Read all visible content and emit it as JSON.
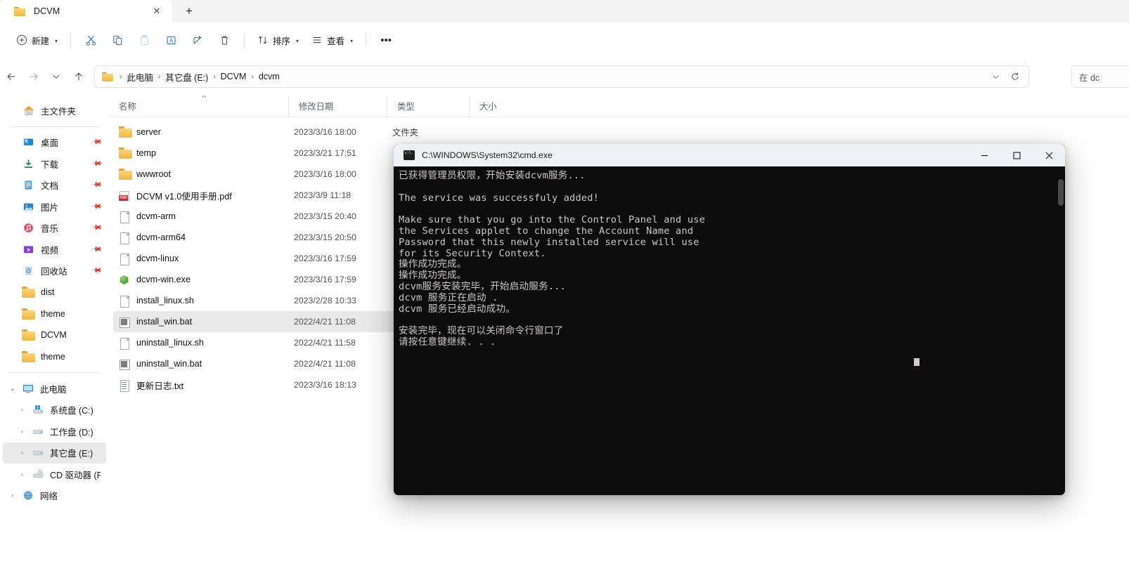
{
  "window": {
    "tab": {
      "title": "DCVM",
      "close_label": "✕",
      "newtab_label": "+"
    }
  },
  "toolbar": {
    "new_label": "新建",
    "cut_label": "cut-icon",
    "copy_label": "copy-icon",
    "paste_label": "paste-icon",
    "rename_label": "rename-icon",
    "share_label": "share-icon",
    "delete_label": "delete-icon",
    "sort_label": "排序",
    "view_label": "查看",
    "more_label": "•••"
  },
  "address": {
    "crumbs": [
      "此电脑",
      "其它盘 (E:)",
      "DCVM",
      "dcvm"
    ],
    "separator": "›",
    "dropdown_label": "⌄",
    "refresh_label": "↻"
  },
  "search": {
    "text": "在 dc"
  },
  "sidebar": {
    "home": {
      "label": "主文件夹",
      "icon": "home-icon"
    },
    "quick": [
      {
        "label": "桌面",
        "icon": "desktop-icon",
        "pinned": true
      },
      {
        "label": "下载",
        "icon": "downloads-icon",
        "pinned": true
      },
      {
        "label": "文档",
        "icon": "documents-icon",
        "pinned": true
      },
      {
        "label": "图片",
        "icon": "pictures-icon",
        "pinned": true
      },
      {
        "label": "音乐",
        "icon": "music-icon",
        "pinned": true
      },
      {
        "label": "视频",
        "icon": "videos-icon",
        "pinned": true
      },
      {
        "label": "回收站",
        "icon": "recyclebin-icon",
        "pinned": true
      },
      {
        "label": "dist",
        "icon": "folder-icon",
        "pinned": false
      },
      {
        "label": "theme",
        "icon": "folder-icon",
        "pinned": false
      },
      {
        "label": "DCVM",
        "icon": "folder-icon",
        "pinned": false
      },
      {
        "label": "theme",
        "icon": "folder-icon",
        "pinned": false
      }
    ],
    "thispc": {
      "label": "此电脑",
      "icon": "pc-icon",
      "expanded": true
    },
    "drives": [
      {
        "label": "系统盘 (C:)",
        "icon": "windrive-icon",
        "selected": false
      },
      {
        "label": "工作盘 (D:)",
        "icon": "drive-icon",
        "selected": false
      },
      {
        "label": "其它盘 (E:)",
        "icon": "drive-icon",
        "selected": true
      },
      {
        "label": "CD 驱动器 (F:)",
        "icon": "cd-icon",
        "selected": false
      }
    ],
    "network": {
      "label": "网络",
      "icon": "network-icon"
    },
    "expander_collapsed": "›",
    "expander_expanded": "⌄"
  },
  "filelist": {
    "columns": [
      "名称",
      "修改日期",
      "类型",
      "大小"
    ],
    "sort_caret": "˄",
    "rows": [
      {
        "name": "server",
        "date": "2023/3/16 18:00",
        "type": "文件夹",
        "size": "",
        "icon": "folder-icon",
        "selected": false
      },
      {
        "name": "temp",
        "date": "2023/3/21 17:51",
        "type": "",
        "size": "",
        "icon": "folder-icon",
        "selected": false
      },
      {
        "name": "wwwroot",
        "date": "2023/3/16 18:00",
        "type": "",
        "size": "",
        "icon": "folder-icon",
        "selected": false
      },
      {
        "name": "DCVM v1.0使用手册.pdf",
        "date": "2023/3/9 11:18",
        "type": "",
        "size": "",
        "icon": "pdf-icon",
        "selected": false
      },
      {
        "name": "dcvm-arm",
        "date": "2023/3/15 20:40",
        "type": "",
        "size": "",
        "icon": "file-icon",
        "selected": false
      },
      {
        "name": "dcvm-arm64",
        "date": "2023/3/15 20:50",
        "type": "",
        "size": "",
        "icon": "file-icon",
        "selected": false
      },
      {
        "name": "dcvm-linux",
        "date": "2023/3/16 17:59",
        "type": "",
        "size": "",
        "icon": "file-icon",
        "selected": false
      },
      {
        "name": "dcvm-win.exe",
        "date": "2023/3/16 17:59",
        "type": "",
        "size": "",
        "icon": "exe-icon",
        "selected": false
      },
      {
        "name": "install_linux.sh",
        "date": "2023/2/28 10:33",
        "type": "",
        "size": "",
        "icon": "file-icon",
        "selected": false
      },
      {
        "name": "install_win.bat",
        "date": "2022/4/21 11:08",
        "type": "",
        "size": "",
        "icon": "bat-icon",
        "selected": true
      },
      {
        "name": "uninstall_linux.sh",
        "date": "2022/4/21 11:58",
        "type": "",
        "size": "",
        "icon": "file-icon",
        "selected": false
      },
      {
        "name": "uninstall_win.bat",
        "date": "2022/4/21 11:08",
        "type": "",
        "size": "",
        "icon": "bat-icon",
        "selected": false
      },
      {
        "name": "更新日志.txt",
        "date": "2023/3/16 18:13",
        "type": "",
        "size": "",
        "icon": "txt-icon",
        "selected": false
      }
    ]
  },
  "console": {
    "title": "C:\\WINDOWS\\System32\\cmd.exe",
    "minimize_label": "—",
    "maximize_label": "☐",
    "close_label": "✕",
    "output": "已获得管理员权限，开始安装dcvm服务...\n\nThe service was successfuly added!\n\nMake sure that you go into the Control Panel and use\nthe Services applet to change the Account Name and\nPassword that this newly installed service will use\nfor its Security Context.\n操作成功完成。\n操作成功完成。\ndcvm服务安装完毕，开始启动服务...\ndcvm 服务正在启动 .\ndcvm 服务已经启动成功。\n\n安装完毕，现在可以关闭命令行窗口了\n请按任意键继续. . ."
  },
  "colors": {
    "accent": "#0078d4",
    "selection": "#e9e9e9",
    "console_bg": "#0c0c0c",
    "console_fg": "#ccc9c8",
    "folder": "#f2b63c"
  }
}
